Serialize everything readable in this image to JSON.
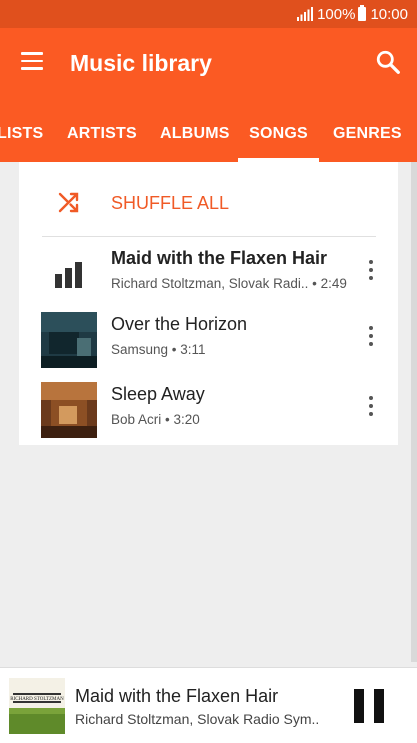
{
  "status": {
    "battery": "100%",
    "time": "10:00"
  },
  "header": {
    "title": "Music library",
    "menu_icon": "hamburger-menu-icon",
    "search_icon": "search-icon"
  },
  "tabs": [
    {
      "label": "LISTS",
      "selected": false
    },
    {
      "label": "ARTISTS",
      "selected": false
    },
    {
      "label": "ALBUMS",
      "selected": false
    },
    {
      "label": "SONGS",
      "selected": true
    },
    {
      "label": "GENRES",
      "selected": false
    }
  ],
  "shuffle": {
    "label": "SHUFFLE ALL",
    "icon": "shuffle-icon"
  },
  "songs": [
    {
      "title": "Maid with the Flaxen Hair",
      "artist": "Richard Stoltzman, Slovak Radi..",
      "duration": "2:49",
      "playing": true,
      "separator": " • "
    },
    {
      "title": "Over the Horizon",
      "artist": "Samsung",
      "duration": "3:11",
      "playing": false,
      "separator": " • "
    },
    {
      "title": "Sleep Away",
      "artist": "Bob Acri",
      "duration": "3:20",
      "playing": false,
      "separator": " • "
    }
  ],
  "now_playing": {
    "title": "Maid with the Flaxen Hair",
    "artist": "Richard Stoltzman, Slovak Radio Sym..",
    "album_art_text": "RICHARD STOLTZMAN"
  },
  "colors": {
    "accent": "#fb5a23",
    "status_bar": "#e0501d",
    "shuffle": "#f05a26"
  }
}
